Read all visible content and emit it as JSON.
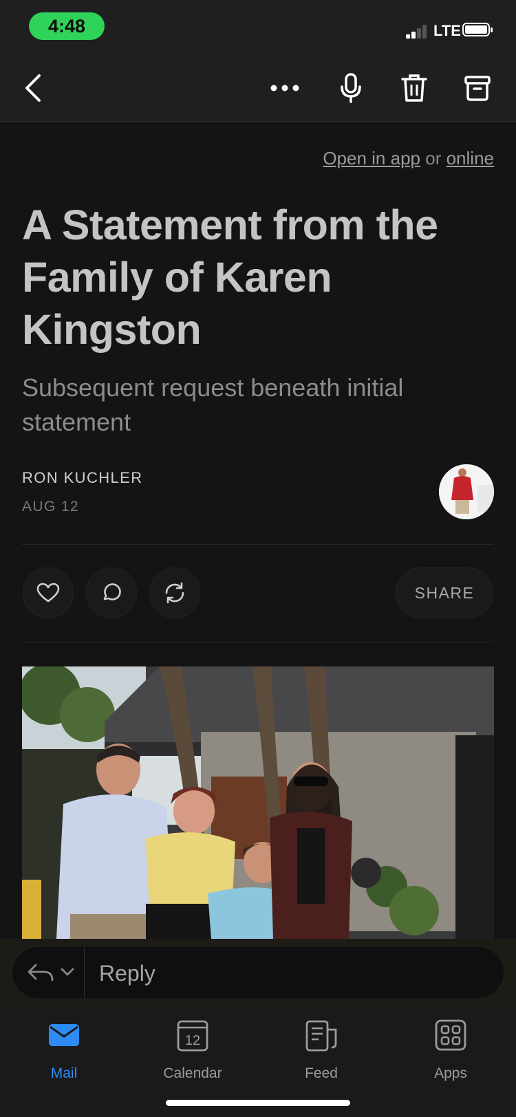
{
  "status_bar": {
    "time": "4:48",
    "network": "LTE"
  },
  "toolbar": {
    "back_icon": "chevron-left-icon",
    "more_icon": "more-horizontal-icon",
    "mic_icon": "microphone-icon",
    "delete_icon": "trash-icon",
    "archive_icon": "archive-icon"
  },
  "email": {
    "open_in_app": "Open in app",
    "or_text": "or",
    "online": "online",
    "title": "A Statement from the Family of Karen Kingston",
    "subtitle": "Subsequent request beneath initial statement",
    "author": "RON KUCHLER",
    "date": "AUG 12",
    "actions": {
      "like_icon": "heart-icon",
      "comment_icon": "comment-icon",
      "restack_icon": "repost-icon",
      "share_label": "SHARE"
    }
  },
  "reply": {
    "label": "Reply"
  },
  "tabs": [
    {
      "label": "Mail",
      "icon": "mail-icon",
      "active": true
    },
    {
      "label": "Calendar",
      "icon": "calendar-icon",
      "day": "12"
    },
    {
      "label": "Feed",
      "icon": "feed-icon"
    },
    {
      "label": "Apps",
      "icon": "apps-grid-icon"
    }
  ],
  "colors": {
    "accent": "#2d8bf5",
    "time_pill": "#2fd35a",
    "background": "#141414"
  }
}
